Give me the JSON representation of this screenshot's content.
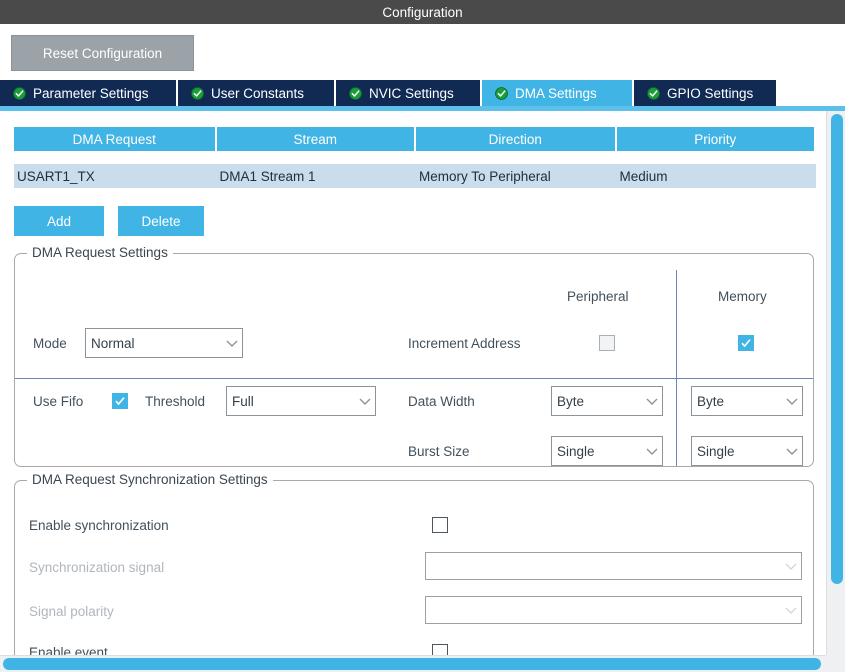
{
  "window": {
    "title": "Configuration"
  },
  "colors": {
    "accent_blue": "#41b4e6",
    "tab_inactive": "#102a54",
    "titlebar": "#4a4a4a",
    "row_selected": "#cbdcea",
    "reset_button": "#9ba2a8"
  },
  "toolbar": {
    "reset_label": "Reset Configuration"
  },
  "tabs": [
    {
      "label": "Parameter Settings",
      "icon": "green-check-circle-icon",
      "active": false
    },
    {
      "label": "User Constants",
      "icon": "green-check-circle-icon",
      "active": false
    },
    {
      "label": "NVIC Settings",
      "icon": "green-check-circle-icon",
      "active": false
    },
    {
      "label": "DMA Settings",
      "icon": "green-check-circle-icon",
      "active": true
    },
    {
      "label": "GPIO Settings",
      "icon": "green-check-circle-icon",
      "active": false
    }
  ],
  "dma_table": {
    "columns": [
      "DMA Request",
      "Stream",
      "Direction",
      "Priority"
    ],
    "rows": [
      {
        "dma_request": "USART1_TX",
        "stream": "DMA1 Stream 1",
        "direction": "Memory To Peripheral",
        "priority": "Medium",
        "selected": true
      }
    ]
  },
  "actions": {
    "add_label": "Add",
    "delete_label": "Delete"
  },
  "request_settings": {
    "legend": "DMA Request Settings",
    "column_headers": {
      "peripheral": "Peripheral",
      "memory": "Memory"
    },
    "mode": {
      "label": "Mode",
      "value": "Normal"
    },
    "increment_address": {
      "label": "Increment Address",
      "peripheral_checked": false,
      "memory_checked": true
    },
    "use_fifo": {
      "label": "Use Fifo",
      "checked": true
    },
    "threshold": {
      "label": "Threshold",
      "value": "Full"
    },
    "data_width": {
      "label": "Data Width",
      "peripheral_value": "Byte",
      "memory_value": "Byte"
    },
    "burst_size": {
      "label": "Burst Size",
      "peripheral_value": "Single",
      "memory_value": "Single"
    }
  },
  "sync_settings": {
    "legend": "DMA Request Synchronization Settings",
    "enable_synchronization": {
      "label": "Enable synchronization",
      "checked": false
    },
    "synchronization_signal": {
      "label": "Synchronization signal",
      "value": "",
      "disabled": true
    },
    "signal_polarity": {
      "label": "Signal polarity",
      "value": "",
      "disabled": true
    },
    "enable_event": {
      "label": "Enable event",
      "checked": false
    }
  }
}
